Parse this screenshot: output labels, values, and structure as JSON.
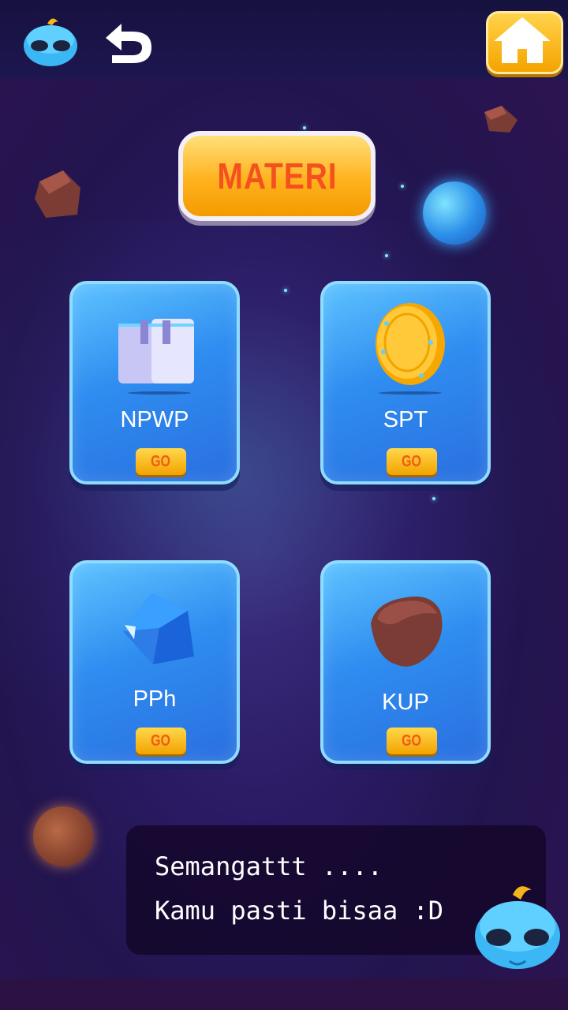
{
  "header": {
    "avatar_icon": "alien-avatar-icon",
    "back_icon": "undo-arrow-icon",
    "home_icon": "home-icon"
  },
  "title": {
    "label": "MATERI"
  },
  "cards": [
    {
      "label": "NPWP",
      "icon": "card-document-icon",
      "go_label": "GO"
    },
    {
      "label": "SPT",
      "icon": "gold-coin-icon",
      "go_label": "GO"
    },
    {
      "label": "PPh",
      "icon": "blue-gem-icon",
      "go_label": "GO"
    },
    {
      "label": "KUP",
      "icon": "brown-rock-icon",
      "go_label": "GO"
    }
  ],
  "message": {
    "line1": "Semangattt ....",
    "line2": "Kamu pasti bisaa :D"
  },
  "colors": {
    "title_button": "#ffb21e",
    "title_text": "#f4511e",
    "card": "#2f8df0",
    "go_button": "#f2a300"
  }
}
